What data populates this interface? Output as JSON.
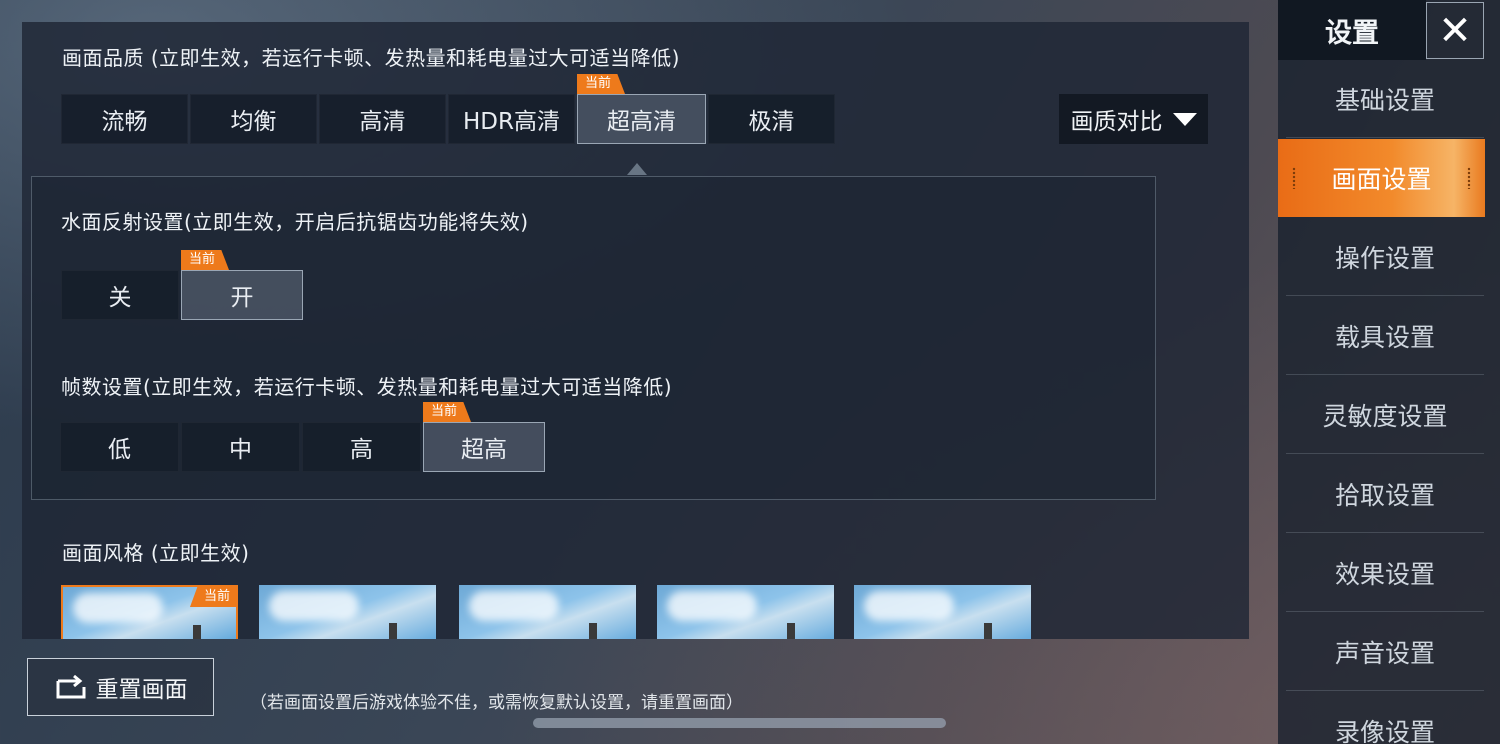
{
  "quality": {
    "title": "画面品质 (立即生效，若运行卡顿、发热量和耗电量过大可适当降低)",
    "options": [
      "流畅",
      "均衡",
      "高清",
      "HDR高清",
      "超高清",
      "极清"
    ],
    "selected_index": 4,
    "current_tag": "当前",
    "compare_label": "画质对比"
  },
  "water": {
    "title": "水面反射设置(立即生效，开启后抗锯齿功能将失效)",
    "options": [
      "关",
      "开"
    ],
    "selected_index": 1,
    "current_tag": "当前"
  },
  "fps": {
    "title": "帧数设置(立即生效，若运行卡顿、发热量和耗电量过大可适当降低)",
    "options": [
      "低",
      "中",
      "高",
      "超高"
    ],
    "selected_index": 3,
    "current_tag": "当前"
  },
  "style": {
    "title": "画面风格 (立即生效)",
    "thumb_count": 5,
    "selected_index": 0,
    "current_tag": "当前"
  },
  "reset": {
    "button_label": "重置画面",
    "hint": "（若画面设置后游戏体验不佳，或需恢复默认设置，请重置画面）"
  },
  "sidebar": {
    "title": "设置",
    "close_icon": "close-icon",
    "items": [
      "基础设置",
      "画面设置",
      "操作设置",
      "载具设置",
      "灵敏度设置",
      "拾取设置",
      "效果设置",
      "声音设置",
      "录像设置"
    ],
    "active_index": 1
  },
  "colors": {
    "accent": "#ee7a1b",
    "panel": "#1e2634"
  }
}
